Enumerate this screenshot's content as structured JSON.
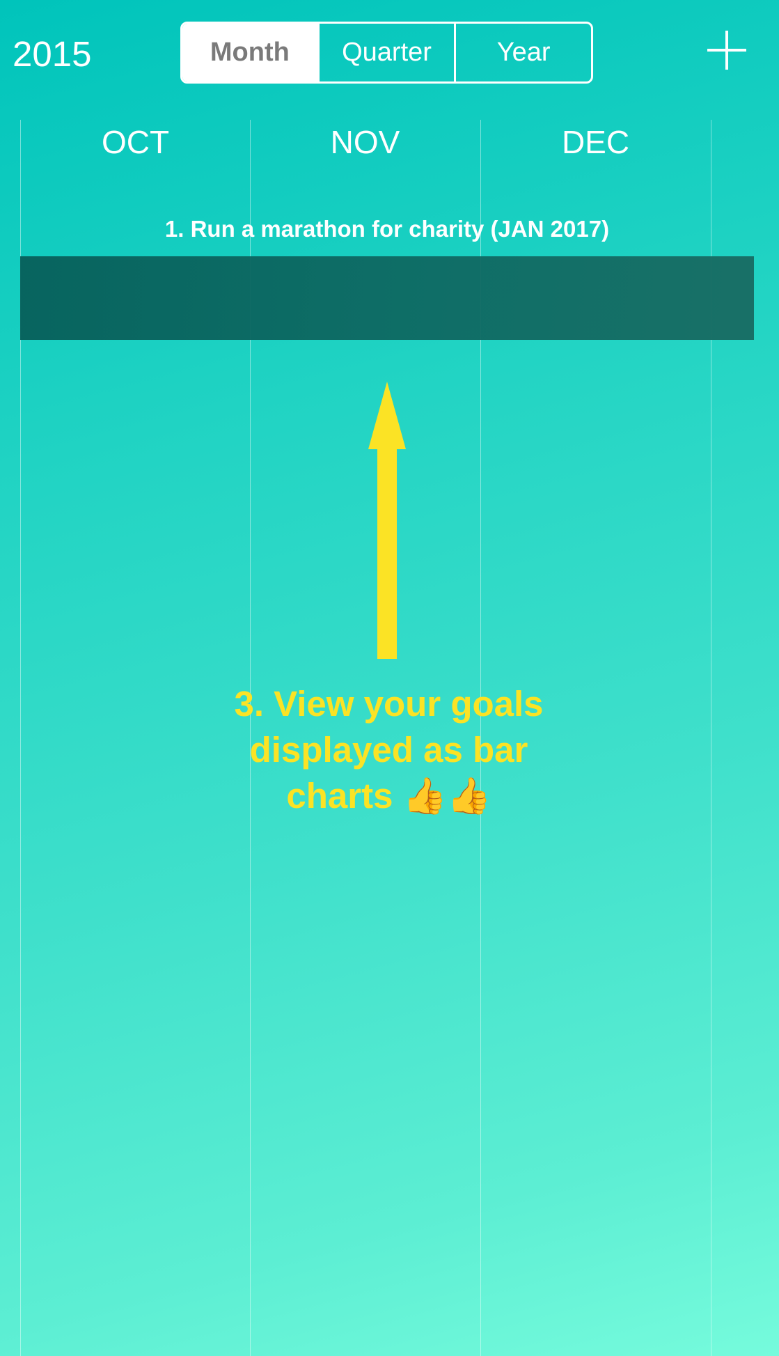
{
  "header": {
    "year": "2015",
    "segments": [
      {
        "label": "Month",
        "selected": true
      },
      {
        "label": "Quarter",
        "selected": false
      },
      {
        "label": "Year",
        "selected": false
      }
    ],
    "add_icon": "plus-icon"
  },
  "timeline": {
    "months": [
      "OCT",
      "NOV",
      "DEC"
    ]
  },
  "goals": [
    {
      "title": "1. Run a marathon for charity (JAN 2017)"
    }
  ],
  "annotation": {
    "text": "3. View your goals displayed as bar charts 👍👍",
    "color": "#fbe325"
  },
  "colors": {
    "background_top": "#00c4bb",
    "background_bottom": "#76fbdc",
    "goal_bar": "#0a635d"
  }
}
